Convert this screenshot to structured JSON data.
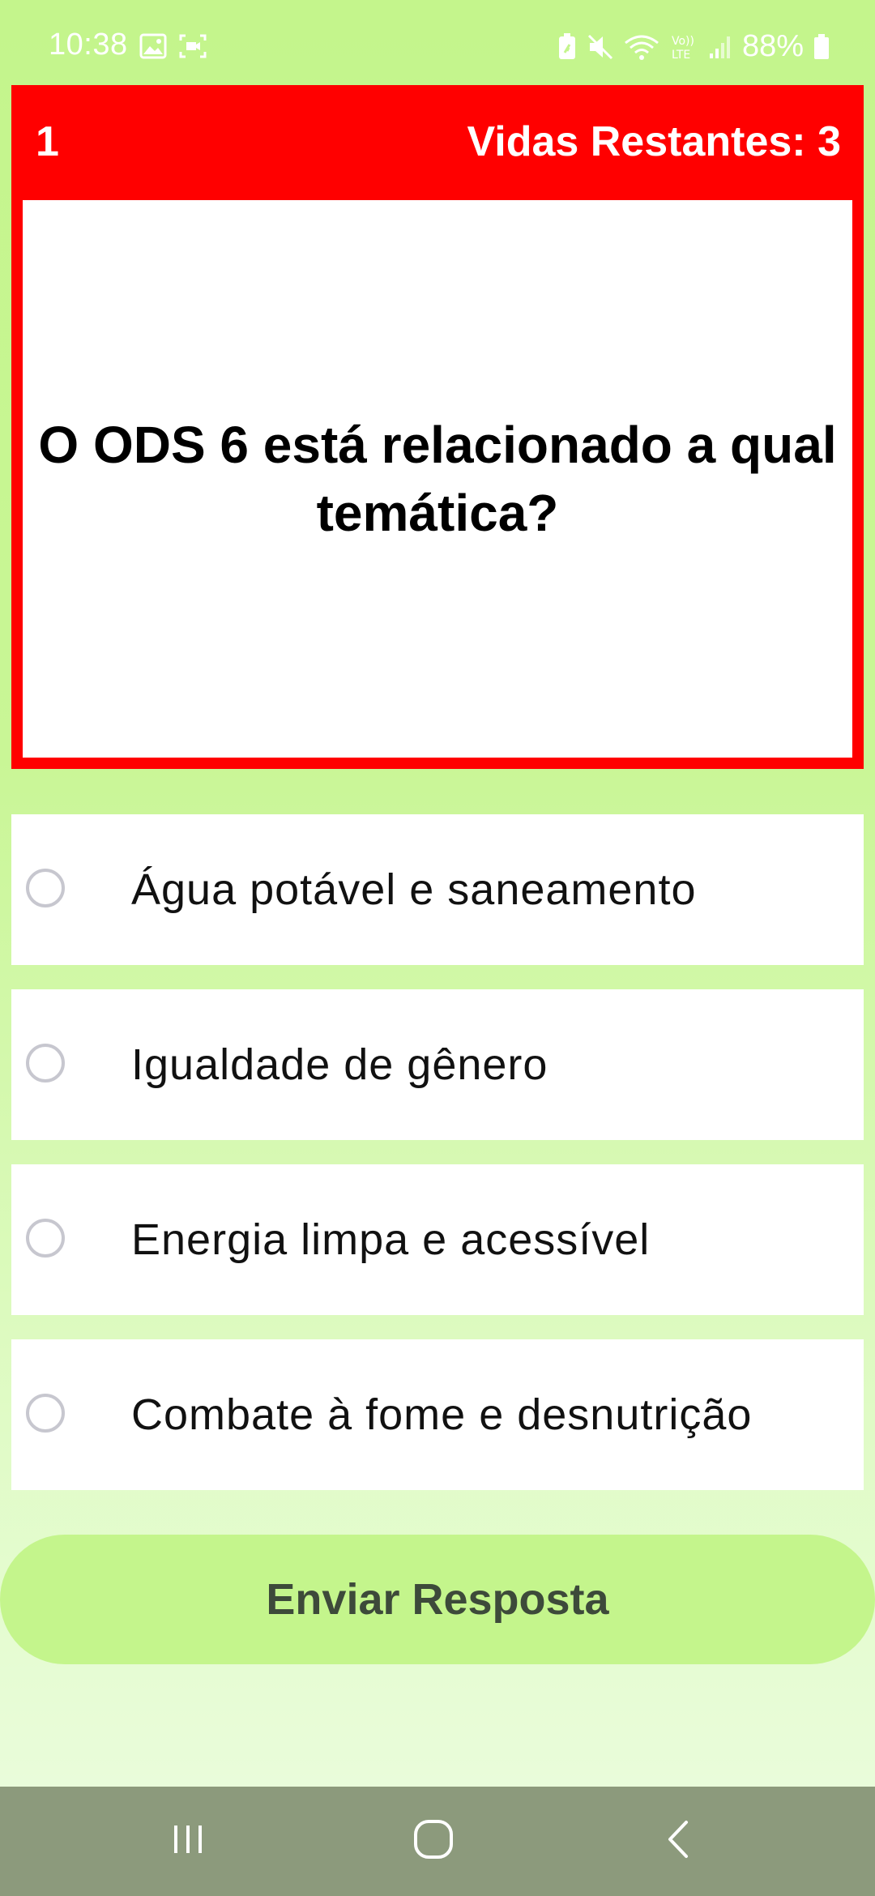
{
  "status_bar": {
    "time": "10:38",
    "battery": "88%",
    "icons": [
      "image-icon",
      "screen-record-icon",
      "battery-saver-icon",
      "mute-icon",
      "wifi-icon",
      "volte-icon",
      "signal-icon",
      "battery-icon"
    ]
  },
  "header": {
    "score": "1",
    "lives": "Vidas Restantes: 3",
    "color": "#ff0000"
  },
  "question": {
    "text": "O ODS 6 está relacionado a qual temática?"
  },
  "options": [
    {
      "label": "Água potável e saneamento",
      "selected": false
    },
    {
      "label": "Igualdade de gênero",
      "selected": false
    },
    {
      "label": "Energia limpa e acessível",
      "selected": false
    },
    {
      "label": "Combate à fome e desnutrição",
      "selected": false
    }
  ],
  "submit": {
    "label": "Enviar Resposta"
  },
  "nav": {
    "icons": [
      "recent-apps-icon",
      "home-icon",
      "back-icon"
    ]
  },
  "colors": {
    "background": "#c4f58c",
    "accent": "#ff0000",
    "button": "#c4f58c",
    "nav_bar": "#8c9a7c"
  }
}
